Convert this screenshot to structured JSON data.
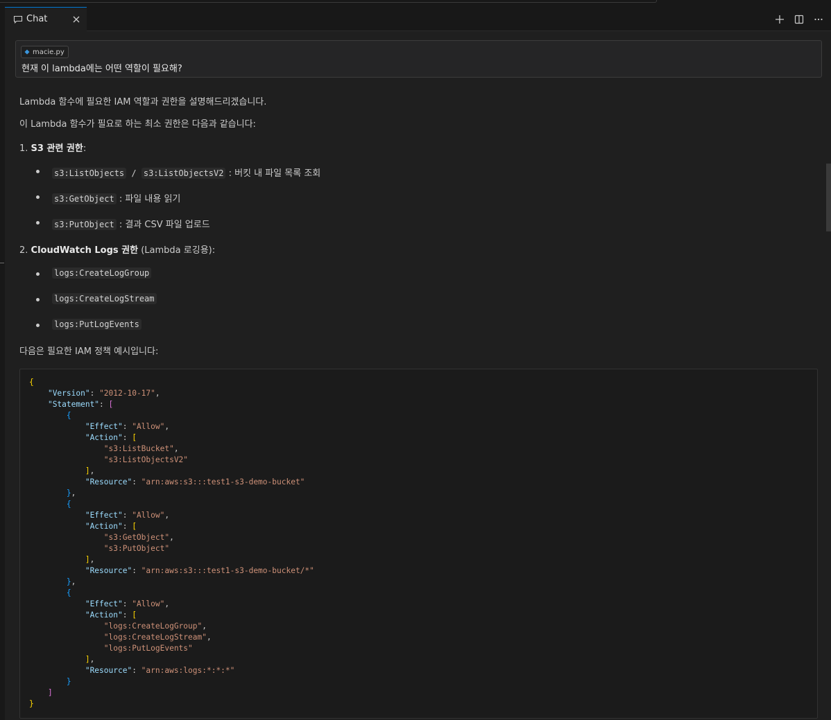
{
  "tab": {
    "label": "Chat"
  },
  "prompt": {
    "file_chip": "macie.py",
    "question": "현재 이 lambda에는 어떤 역할이 필요해?"
  },
  "response": {
    "intro": "Lambda 함수에 필요한 IAM 역할과 권한을 설명해드리겠습니다.",
    "min_perms": "이 Lambda 함수가 필요로 하는 최소 권한은 다음과 같습니다:",
    "s3_heading_num": "1. ",
    "s3_heading_bold": "S3 관련 권한",
    "s3_heading_tail": ":",
    "s3_items": [
      {
        "code": "s3:ListObjects",
        "sep": " / ",
        "code2": "s3:ListObjectsV2",
        "desc": " : 버킷 내 파일 목록 조회"
      },
      {
        "code": "s3:GetObject",
        "desc": " : 파일 내용 읽기"
      },
      {
        "code": "s3:PutObject",
        "desc": " : 결과 CSV 파일 업로드"
      }
    ],
    "cw_heading_num": "2. ",
    "cw_heading_bold": "CloudWatch Logs 권한",
    "cw_heading_tail": " (Lambda 로깅용):",
    "cw_items": [
      "logs:CreateLogGroup",
      "logs:CreateLogStream",
      "logs:PutLogEvents"
    ],
    "policy_intro": "다음은 필요한 IAM 정책 예시입니다:"
  },
  "policy": {
    "version_key": "\"Version\"",
    "version_val": "\"2012-10-17\"",
    "statement_key": "\"Statement\"",
    "effect_key": "\"Effect\"",
    "allow": "\"Allow\"",
    "action_key": "\"Action\"",
    "resource_key": "\"Resource\"",
    "s1_actions": [
      "\"s3:ListBucket\"",
      "\"s3:ListObjectsV2\""
    ],
    "s1_resource": "\"arn:aws:s3:::test1-s3-demo-bucket\"",
    "s2_actions": [
      "\"s3:GetObject\"",
      "\"s3:PutObject\""
    ],
    "s2_resource": "\"arn:aws:s3:::test1-s3-demo-bucket/*\"",
    "s3_actions": [
      "\"logs:CreateLogGroup\"",
      "\"logs:CreateLogStream\"",
      "\"logs:PutLogEvents\""
    ],
    "s3_resource": "\"arn:aws:logs:*:*:*\""
  },
  "icons": {
    "chat": "chat-bubble-icon",
    "close": "close-icon",
    "new": "plus-icon",
    "split": "split-editor-icon",
    "more": "more-ellipsis-icon",
    "file": "python-file-icon"
  },
  "colors": {
    "accent": "#0078d4",
    "key": "#9cdcfe",
    "string": "#ce9178",
    "bracket1": "#ffd700",
    "bracket2": "#da70d6",
    "bracket3": "#179fff"
  }
}
